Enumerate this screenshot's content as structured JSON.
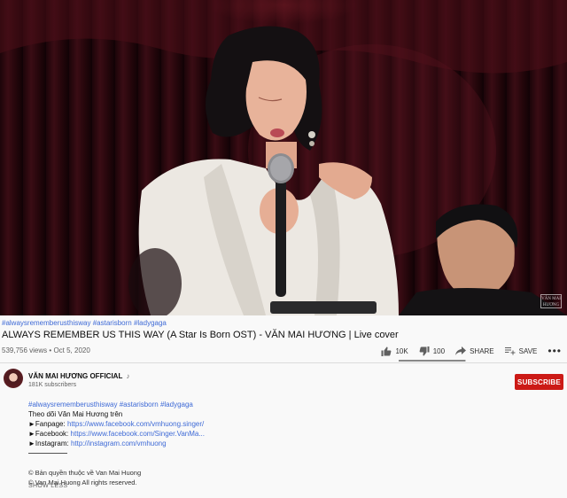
{
  "video": {
    "watermark": "VÂN MAI HƯƠNG"
  },
  "info": {
    "hashtags": "#alwaysrememberusthisway #astarisborn #ladygaga",
    "title": "ALWAYS REMEMBER US THIS WAY (A Star Is Born OST) - VĂN MAI HƯƠNG | Live cover",
    "views": "539,756 views",
    "separator": "•",
    "date": "Oct 5, 2020"
  },
  "actions": {
    "likes": "10K",
    "dislikes": "100",
    "share_label": "SHARE",
    "save_label": "SAVE",
    "more_label": "•••",
    "like_ratio": 0.99
  },
  "channel": {
    "name": "VĂN MAI HƯƠNG OFFICIAL",
    "verified_note": "♪",
    "subscribers": "181K subscribers",
    "subscribe_label": "SUBSCRIBE"
  },
  "description": {
    "hashtags": "#alwaysrememberusthisway #astarisborn #ladygaga",
    "follow_line": "Theo dõi Văn Mai Hương trên",
    "fanpage_label": "►Fanpage:",
    "fanpage_url": "https://www.facebook.com/vmhuong.singer/",
    "facebook_label": "►Facebook:",
    "facebook_url": "https://www.facebook.com/Singer.VanMa...",
    "instagram_label": "►Instagram:",
    "instagram_url": "http://instagram.com/vmhuong",
    "copyright_1": "© Bản quyền thuộc về Van Mai Huong",
    "copyright_2": "© Van Mai Huong All rights reserved.",
    "show_less": "SHOW LESS"
  },
  "colors": {
    "subscribe_bg": "#cc1a16",
    "link": "#3e6ad6",
    "stage_curtain": "#3a0c14"
  }
}
